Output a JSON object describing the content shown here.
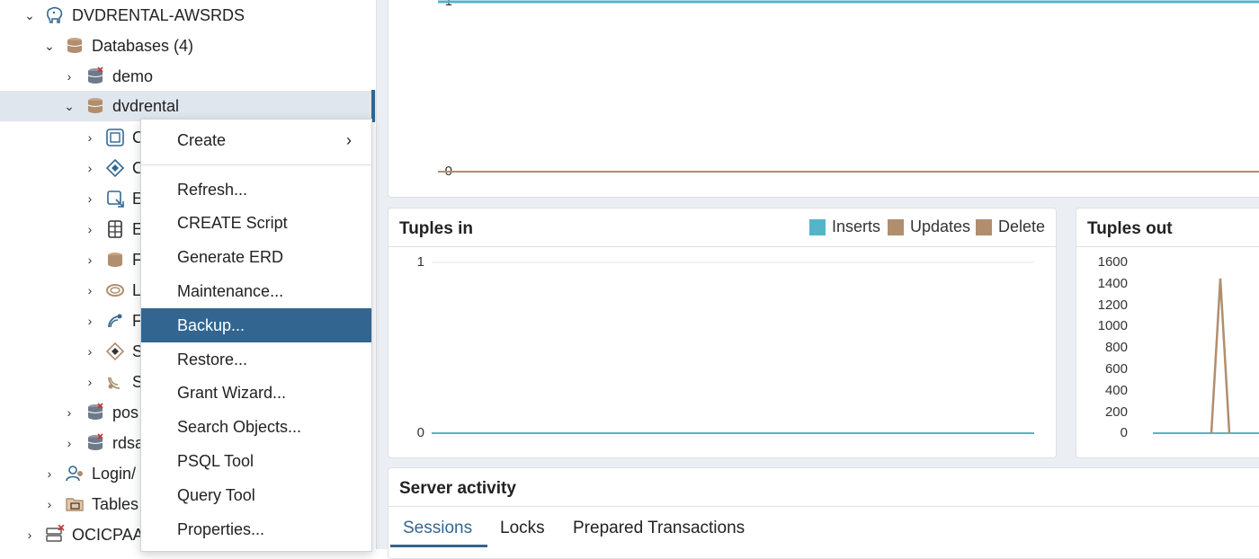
{
  "tree": {
    "server": "DVDRENTAL-AWSRDS",
    "databases": "Databases (4)",
    "db_demo": "demo",
    "db_dvdrental": "dvdrental",
    "child_letters": [
      "C",
      "C",
      "E",
      "E",
      "F",
      "L",
      "F",
      "S",
      "S"
    ],
    "db_pos": "pos",
    "db_rds": "rdsa",
    "login": "Login/",
    "tables": "Tables",
    "oci": "OCICPAA"
  },
  "context_menu": {
    "items": [
      "Create",
      "Refresh...",
      "CREATE Script",
      "Generate ERD",
      "Maintenance...",
      "Backup...",
      "Restore...",
      "Grant Wizard...",
      "Search Objects...",
      "PSQL Tool",
      "Query Tool",
      "Properties..."
    ],
    "active": "Backup..."
  },
  "top_chart": {
    "y_ticks": [
      "1",
      "0"
    ]
  },
  "tuples_in": {
    "title": "Tuples in",
    "legend": [
      "Inserts",
      "Updates",
      "Delete"
    ],
    "y_ticks": [
      "1",
      "0"
    ]
  },
  "tuples_out": {
    "title": "Tuples out",
    "y_ticks": [
      "1600",
      "1400",
      "1200",
      "1000",
      "800",
      "600",
      "400",
      "200",
      "0"
    ]
  },
  "server_activity": {
    "title": "Server activity",
    "tabs": [
      "Sessions",
      "Locks",
      "Prepared Transactions"
    ],
    "active_tab": "Sessions"
  },
  "colors": {
    "inserts": "#56b4c9",
    "updates": "#b08e6e",
    "delete": "#b08e6e",
    "accent": "#326690"
  },
  "chart_data": [
    {
      "type": "line",
      "title": "",
      "series": [
        {
          "values": [
            1
          ]
        },
        {
          "values": [
            0
          ]
        }
      ],
      "ylim": [
        0,
        1
      ]
    },
    {
      "type": "line",
      "title": "Tuples in",
      "series": [
        {
          "name": "Inserts",
          "values": [
            0
          ]
        },
        {
          "name": "Updates",
          "values": [
            0
          ]
        },
        {
          "name": "Delete",
          "values": [
            0
          ]
        }
      ],
      "ylim": [
        0,
        1
      ]
    },
    {
      "type": "line",
      "title": "Tuples out",
      "series": [
        {
          "values": [
            0,
            0,
            0,
            1450,
            0,
            0,
            0
          ]
        }
      ],
      "ylim": [
        0,
        1600
      ]
    }
  ]
}
